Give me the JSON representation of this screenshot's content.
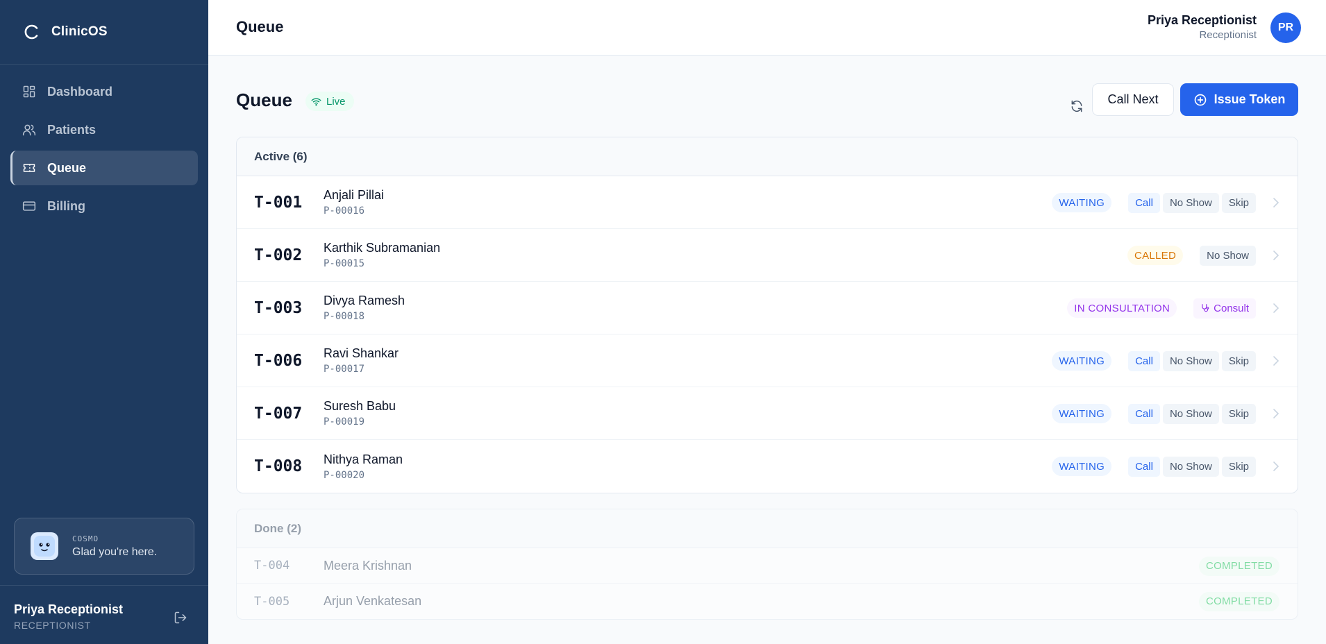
{
  "brand": {
    "name": "ClinicOS"
  },
  "sidebar": {
    "items": [
      {
        "label": "Dashboard"
      },
      {
        "label": "Patients"
      },
      {
        "label": "Queue"
      },
      {
        "label": "Billing"
      }
    ],
    "cosmo": {
      "tag": "COSMO",
      "message": "Glad you're here."
    },
    "user": {
      "name": "Priya Receptionist",
      "role": "RECEPTIONIST"
    }
  },
  "header": {
    "title": "Queue",
    "user": {
      "name": "Priya Receptionist",
      "role": "Receptionist",
      "initials": "PR"
    }
  },
  "main": {
    "title": "Queue",
    "live_label": "Live",
    "call_next_label": "Call Next",
    "issue_token_label": "Issue Token",
    "active_header": "Active (6)",
    "done_header": "Done (2)",
    "active": [
      {
        "token": "T-001",
        "name": "Anjali Pillai",
        "pid": "P-00016",
        "status": "WAITING",
        "actions": [
          "Call",
          "No Show",
          "Skip"
        ]
      },
      {
        "token": "T-002",
        "name": "Karthik Subramanian",
        "pid": "P-00015",
        "status": "CALLED",
        "actions": [
          "No Show"
        ]
      },
      {
        "token": "T-003",
        "name": "Divya Ramesh",
        "pid": "P-00018",
        "status": "IN CONSULTATION",
        "actions": [
          "Consult"
        ]
      },
      {
        "token": "T-006",
        "name": "Ravi Shankar",
        "pid": "P-00017",
        "status": "WAITING",
        "actions": [
          "Call",
          "No Show",
          "Skip"
        ]
      },
      {
        "token": "T-007",
        "name": "Suresh Babu",
        "pid": "P-00019",
        "status": "WAITING",
        "actions": [
          "Call",
          "No Show",
          "Skip"
        ]
      },
      {
        "token": "T-008",
        "name": "Nithya Raman",
        "pid": "P-00020",
        "status": "WAITING",
        "actions": [
          "Call",
          "No Show",
          "Skip"
        ]
      }
    ],
    "done": [
      {
        "token": "T-004",
        "name": "Meera Krishnan",
        "status": "COMPLETED"
      },
      {
        "token": "T-005",
        "name": "Arjun Venkatesan",
        "status": "COMPLETED"
      }
    ]
  },
  "colors": {
    "sidebar_bg": "#1e3a5f",
    "primary": "#2563eb",
    "waiting": "#2563eb",
    "called": "#d97706",
    "in_consultation": "#9333ea",
    "completed": "#22c55e",
    "live": "#059669"
  }
}
